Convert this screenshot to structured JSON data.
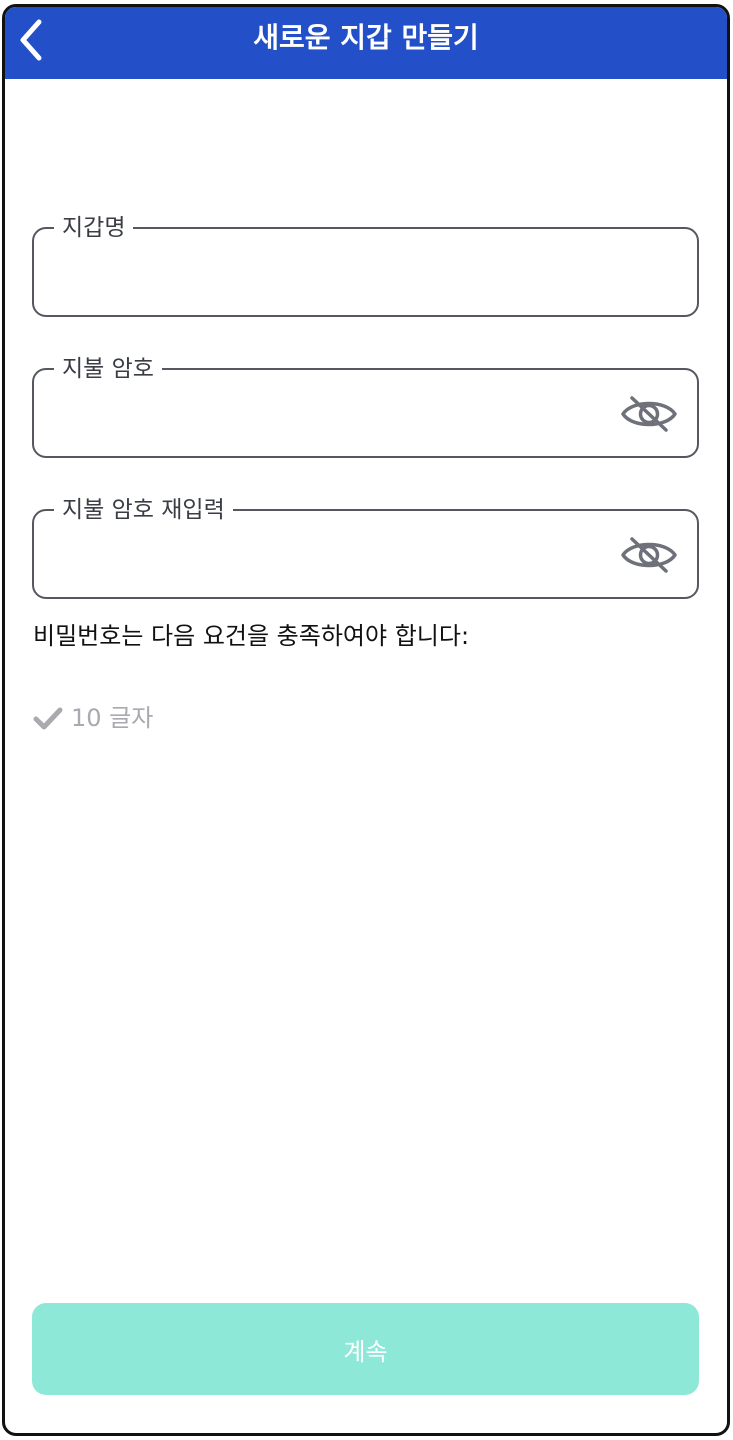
{
  "header": {
    "title": "새로운 지갑 만들기",
    "back_icon": "chevron-left-icon"
  },
  "form": {
    "wallet_name": {
      "label": "지갑명",
      "value": ""
    },
    "password": {
      "label": "지불 암호",
      "value": "",
      "toggle_icon": "eye-off-icon"
    },
    "password_confirm": {
      "label": "지불 암호 재입력",
      "value": "",
      "toggle_icon": "eye-off-icon"
    }
  },
  "requirements": {
    "title": "비밀번호는 다음 요건을 충족하여야 합니다:",
    "items": [
      {
        "text": "10 글자",
        "met": false
      }
    ]
  },
  "footer": {
    "continue_label": "계속",
    "enabled": false
  },
  "colors": {
    "header_bg": "#2350c8",
    "button_bg_disabled": "#8ee8d8",
    "border": "#555860",
    "muted_text": "#a8aab0"
  }
}
